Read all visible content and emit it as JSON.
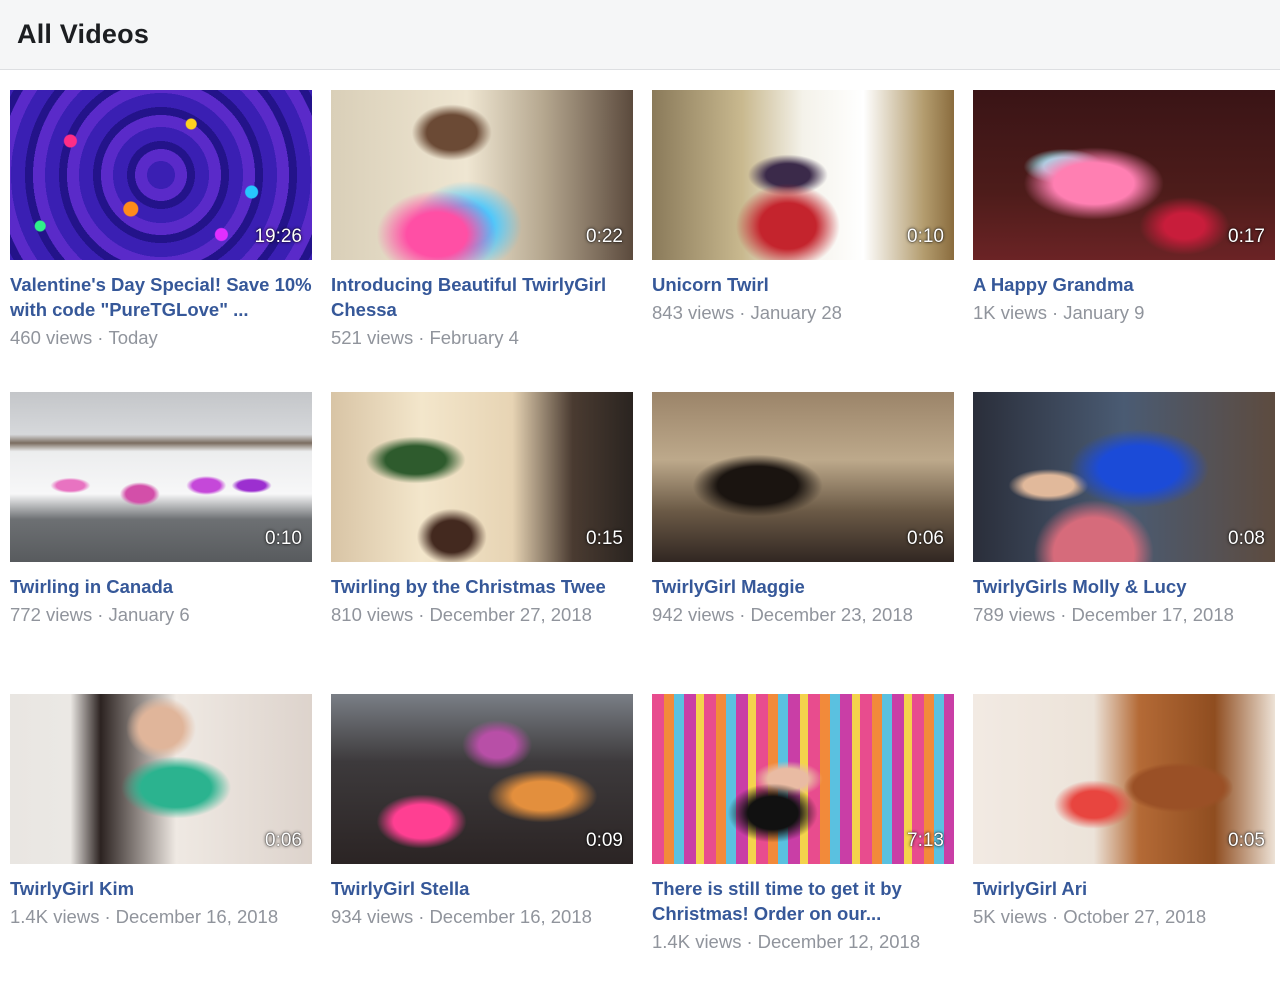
{
  "header": {
    "title": "All Videos"
  },
  "videos": [
    {
      "title": "Valentine's Day Special! Save 10% with code \"PureTGLove\" ...",
      "views": "460 views",
      "date": "Today",
      "duration": "19:26"
    },
    {
      "title": "Introducing Beautiful TwirlyGirl Chessa",
      "views": "521 views",
      "date": "February 4",
      "duration": "0:22"
    },
    {
      "title": "Unicorn Twirl",
      "views": "843 views",
      "date": "January 28",
      "duration": "0:10"
    },
    {
      "title": "A Happy Grandma",
      "views": "1K views",
      "date": "January 9",
      "duration": "0:17"
    },
    {
      "title": "Twirling in Canada",
      "views": "772 views",
      "date": "January 6",
      "duration": "0:10"
    },
    {
      "title": "Twirling by the Christmas Twee",
      "views": "810 views",
      "date": "December 27, 2018",
      "duration": "0:15"
    },
    {
      "title": "TwirlyGirl Maggie",
      "views": "942 views",
      "date": "December 23, 2018",
      "duration": "0:06"
    },
    {
      "title": "TwirlyGirls Molly & Lucy",
      "views": "789 views",
      "date": "December 17, 2018",
      "duration": "0:08"
    },
    {
      "title": "TwirlyGirl Kim",
      "views": "1.4K views",
      "date": "December 16, 2018",
      "duration": "0:06"
    },
    {
      "title": "TwirlyGirl Stella",
      "views": "934 views",
      "date": "December 16, 2018",
      "duration": "0:09"
    },
    {
      "title": "There is still time to get it by Christmas! Order on our...",
      "views": "1.4K views",
      "date": "December 12, 2018",
      "duration": "7:13"
    },
    {
      "title": "TwirlyGirl Ari",
      "views": "5K views",
      "date": "October 27, 2018",
      "duration": "0:05"
    }
  ],
  "separator": "·",
  "colors": {
    "title": "#365899",
    "meta": "#90949c",
    "header_bg": "#f5f6f7"
  }
}
